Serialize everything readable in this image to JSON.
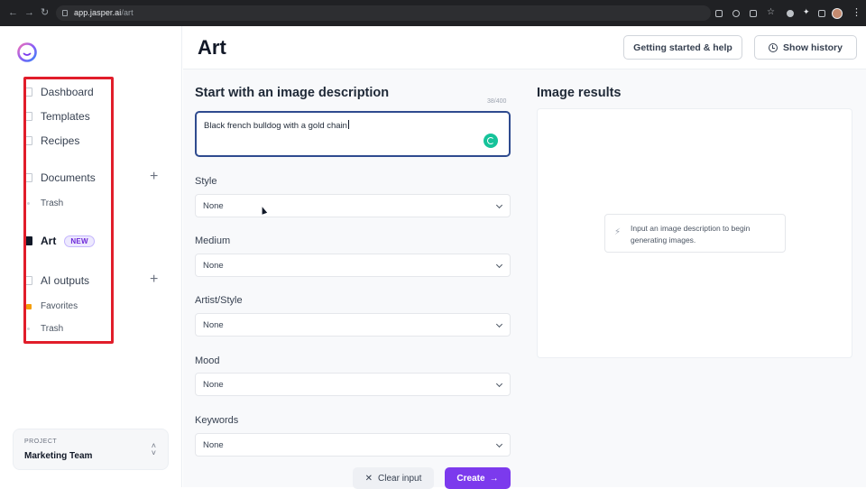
{
  "browser": {
    "back_icon": "arrow-left-icon",
    "forward_icon": "arrow-right-icon",
    "reload_icon": "reload-icon",
    "url_host": "app.jasper.ai",
    "url_path": "/art"
  },
  "sidebar": {
    "logo": "jasper-logo",
    "items": [
      {
        "label": "Dashboard",
        "icon": "home-icon"
      },
      {
        "label": "Templates",
        "icon": "grid-icon"
      },
      {
        "label": "Recipes",
        "icon": "book-icon"
      },
      {
        "label": "Documents",
        "icon": "document-icon"
      },
      {
        "label": "Trash",
        "icon": "dot-icon"
      },
      {
        "label": "Art",
        "icon": "image-icon",
        "badge": "NEW"
      },
      {
        "label": "AI outputs",
        "icon": "document-icon"
      },
      {
        "label": "Favorites",
        "icon": "star-icon"
      },
      {
        "label": "Trash",
        "icon": "dot-icon"
      }
    ],
    "project": {
      "label": "PROJECT",
      "name": "Marketing Team"
    }
  },
  "header": {
    "title": "Art",
    "help_button": "Getting started & help",
    "history_button": "Show history"
  },
  "form": {
    "heading": "Start with an image description",
    "counter": "38/400",
    "description_value": "Black french bulldog with a gold chain",
    "fields": [
      {
        "label": "Style",
        "value": "None"
      },
      {
        "label": "Medium",
        "value": "None"
      },
      {
        "label": "Artist/Style",
        "value": "None"
      },
      {
        "label": "Mood",
        "value": "None"
      },
      {
        "label": "Keywords",
        "value": "None"
      }
    ],
    "clear_button": "Clear input",
    "create_button": "Create",
    "accent_color": "#7c3aed"
  },
  "results": {
    "heading": "Image results",
    "hint": "Input an image description to begin generating images."
  },
  "annotation": {
    "highlight_color": "#e11d2a"
  }
}
